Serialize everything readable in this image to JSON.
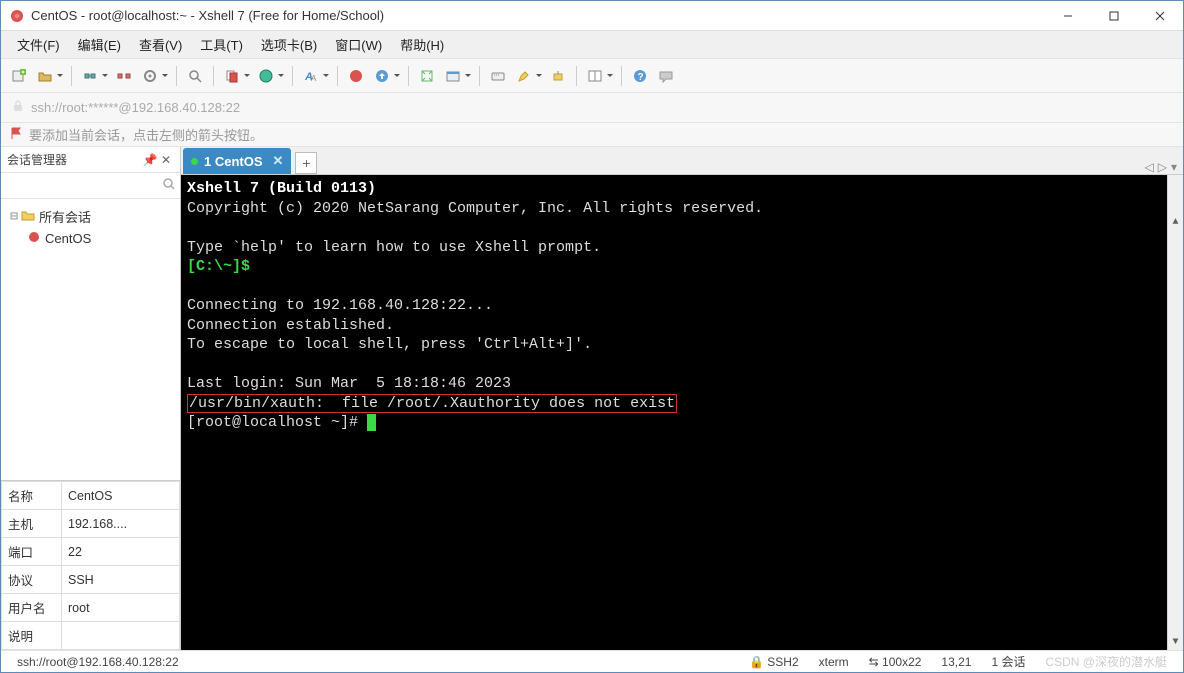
{
  "window": {
    "title": "CentOS - root@localhost:~ - Xshell 7 (Free for Home/School)"
  },
  "menu": {
    "file": "文件(F)",
    "edit": "编辑(E)",
    "view": "查看(V)",
    "tools": "工具(T)",
    "tabs": "选项卡(B)",
    "window": "窗口(W)",
    "help": "帮助(H)"
  },
  "address": {
    "url": "ssh://root:******@192.168.40.128:22"
  },
  "hint": {
    "text": "要添加当前会话，点击左侧的箭头按钮。"
  },
  "sidebar": {
    "title": "会话管理器",
    "search_placeholder": "",
    "nodes": {
      "root": "所有会话",
      "child": "CentOS"
    },
    "props": [
      {
        "k": "名称",
        "v": "CentOS"
      },
      {
        "k": "主机",
        "v": "192.168...."
      },
      {
        "k": "端口",
        "v": "22"
      },
      {
        "k": "协议",
        "v": "SSH"
      },
      {
        "k": "用户名",
        "v": "root"
      },
      {
        "k": "说明",
        "v": ""
      }
    ]
  },
  "tab": {
    "num": "1",
    "label": "CentOS"
  },
  "terminal": {
    "l1": "Xshell 7 (Build 0113)",
    "l2": "Copyright (c) 2020 NetSarang Computer, Inc. All rights reserved.",
    "l3": "Type `help' to learn how to use Xshell prompt.",
    "l4": "[C:\\~]$",
    "l5": "Connecting to 192.168.40.128:22...",
    "l6": "Connection established.",
    "l7": "To escape to local shell, press 'Ctrl+Alt+]'.",
    "l8": "Last login: Sun Mar  5 18:18:46 2023",
    "l9": "/usr/bin/xauth:  file /root/.Xauthority does not exist",
    "l10": "[root@localhost ~]# "
  },
  "status": {
    "url": "ssh://root@192.168.40.128:22",
    "type": "SSH2",
    "term": "xterm",
    "size": "100x22",
    "pos": "13,21",
    "sess": "1 会话",
    "watermark": "CSDN @深夜的潜水艇"
  }
}
